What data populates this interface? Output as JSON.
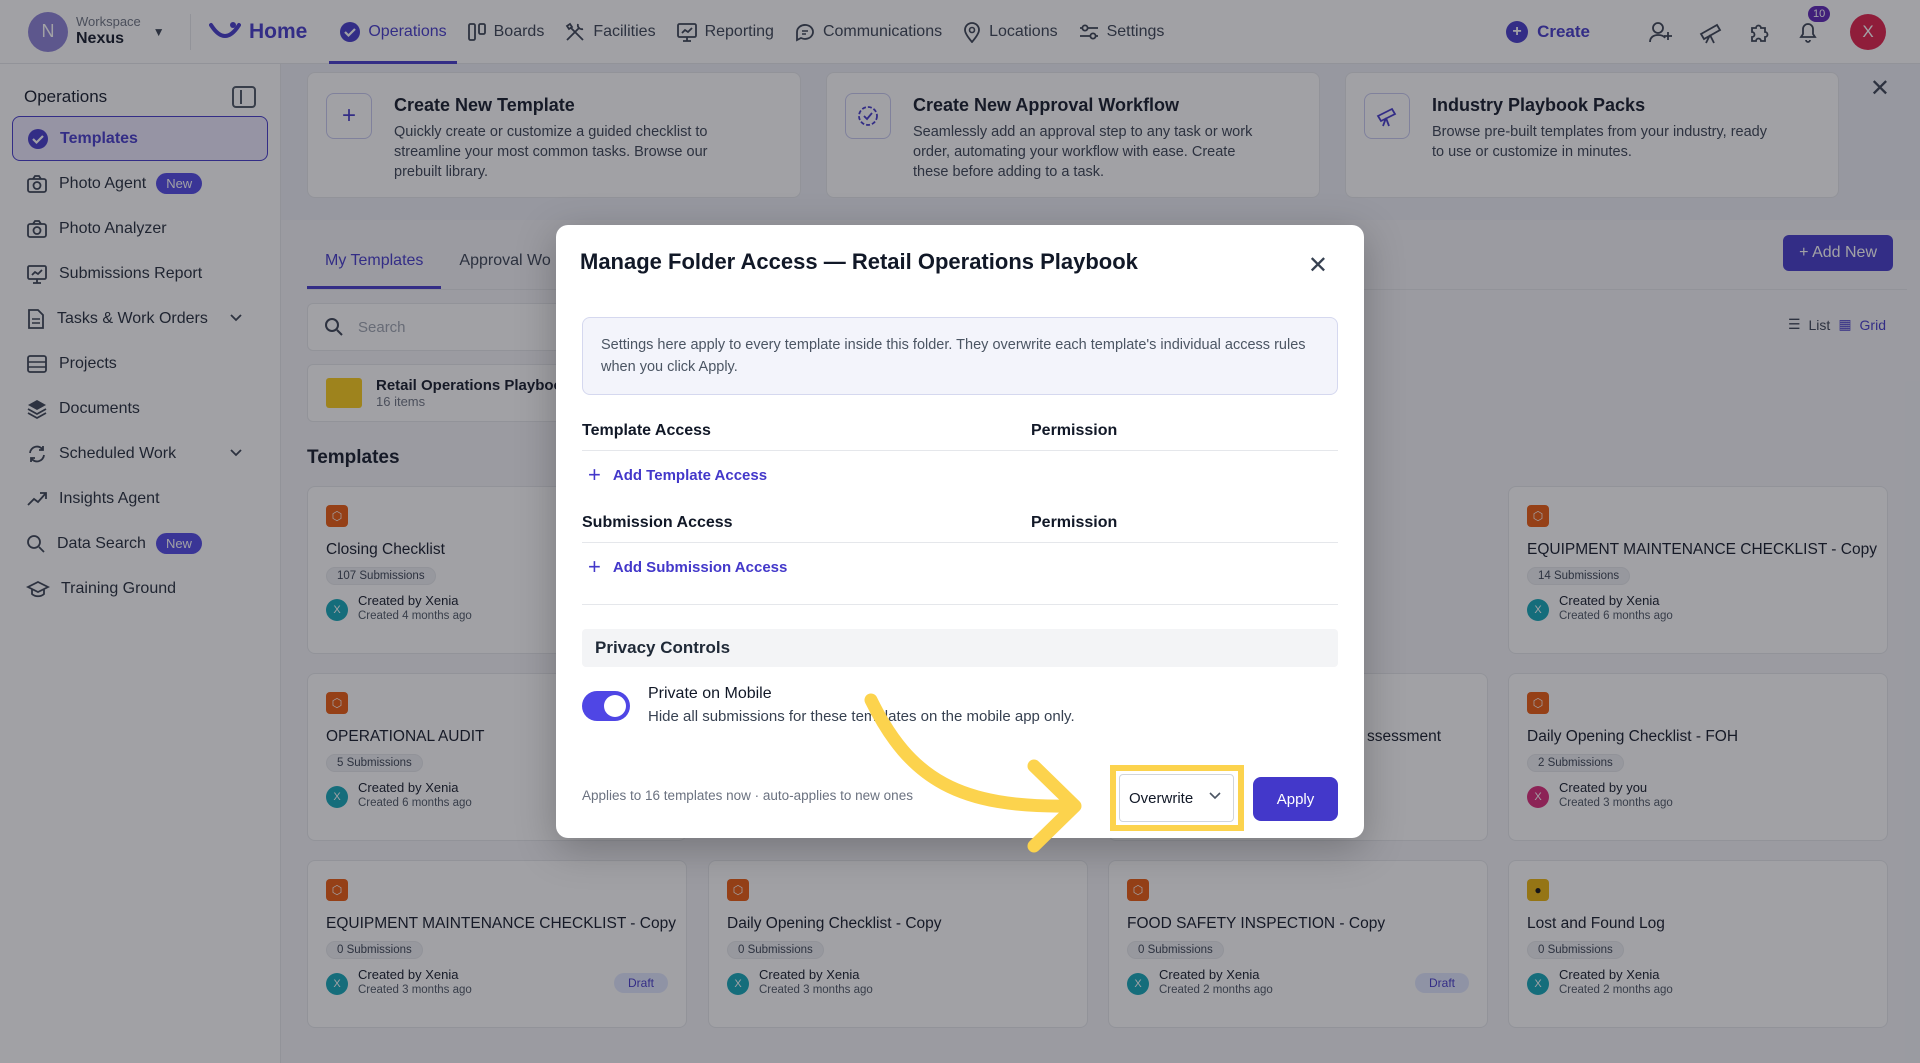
{
  "topnav": {
    "workspace_label": "Workspace",
    "workspace_name": "Nexus",
    "workspace_initial": "N",
    "home": "Home",
    "items": [
      "Operations",
      "Boards",
      "Facilities",
      "Reporting",
      "Communications",
      "Locations",
      "Settings"
    ],
    "active_item": "Operations",
    "create": "Create",
    "notifications_count": "10",
    "user_initial": "X"
  },
  "sidebar": {
    "title": "Operations",
    "items": [
      {
        "label": "Templates",
        "icon": "check-circle-icon",
        "active": true
      },
      {
        "label": "Photo Agent",
        "icon": "camera-icon",
        "badge": "New"
      },
      {
        "label": "Photo Analyzer",
        "icon": "camera-icon"
      },
      {
        "label": "Submissions Report",
        "icon": "report-icon"
      },
      {
        "label": "Tasks & Work Orders",
        "icon": "document-icon",
        "expandable": true
      },
      {
        "label": "Projects",
        "icon": "projects-icon"
      },
      {
        "label": "Documents",
        "icon": "layers-icon"
      },
      {
        "label": "Scheduled Work",
        "icon": "refresh-icon",
        "expandable": true
      },
      {
        "label": "Insights Agent",
        "icon": "trend-icon"
      },
      {
        "label": "Data Search",
        "icon": "search-icon",
        "badge": "New"
      },
      {
        "label": "Training Ground",
        "icon": "graduation-icon"
      }
    ]
  },
  "promo": [
    {
      "title": "Create New Template",
      "desc": "Quickly create or customize a guided checklist to streamline your most common tasks. Browse our prebuilt library.",
      "icon": "plus-icon"
    },
    {
      "title": "Create New Approval Workflow",
      "desc": "Seamlessly add an approval step to any task or work order, automating your workflow with ease. Create these before adding to a task.",
      "icon": "approval-icon"
    },
    {
      "title": "Industry Playbook Packs",
      "desc": "Browse pre-built templates from your industry, ready to use or customize in minutes.",
      "icon": "telescope-icon"
    }
  ],
  "tabs": [
    "My Templates",
    "Approval Wo"
  ],
  "add_new": "Add New",
  "view_toggle": {
    "list": "List",
    "grid": "Grid"
  },
  "search_placeholder": "Search",
  "folder": {
    "name": "Retail Operations Playboo",
    "count": "16 items"
  },
  "templates_title": "Templates",
  "cards": [
    {
      "title": "Closing Checklist",
      "subs": "107 Submissions",
      "by": "Created by Xenia",
      "ago": "Created 4 months ago",
      "av": "X"
    },
    {
      "title": "EQUIPMENT MAINTENANCE CHECKLIST - Copy",
      "subs": "14 Submissions",
      "by": "Created by Xenia",
      "ago": "Created 6 months ago",
      "av": "X"
    },
    {
      "title": "OPERATIONAL AUDIT",
      "subs": "5 Submissions",
      "by": "Created by Xenia",
      "ago": "Created 6 months ago",
      "av": "X"
    },
    {
      "title": "ssessment",
      "subs": "",
      "by": "",
      "ago": "",
      "av": ""
    },
    {
      "title": "Daily Opening Checklist - FOH",
      "subs": "2 Submissions",
      "by": "Created by you",
      "ago": "Created 3 months ago",
      "av": "X"
    },
    {
      "title": "EQUIPMENT MAINTENANCE CHECKLIST - Copy",
      "subs": "0 Submissions",
      "by": "Created by Xenia",
      "ago": "Created 3 months ago",
      "av": "X",
      "draft": "Draft"
    },
    {
      "title": "Daily Opening Checklist - Copy",
      "subs": "0 Submissions",
      "by": "Created by Xenia",
      "ago": "Created 3 months ago",
      "av": "X"
    },
    {
      "title": "FOOD SAFETY INSPECTION - Copy",
      "subs": "0 Submissions",
      "by": "Created by Xenia",
      "ago": "Created 2 months ago",
      "av": "X",
      "draft": "Draft"
    },
    {
      "title": "Lost and Found Log",
      "subs": "0 Submissions",
      "by": "Created by Xenia",
      "ago": "Created 2 months ago",
      "av": "X"
    }
  ],
  "modal": {
    "title": "Manage Folder Access — Retail Operations Playbook",
    "info": "Settings here apply to every template inside this folder. They overwrite each template's individual access rules when you click Apply.",
    "template_access": "Template Access",
    "permission": "Permission",
    "add_template_access": "Add Template Access",
    "submission_access": "Submission Access",
    "add_submission_access": "Add Submission Access",
    "privacy_controls": "Privacy Controls",
    "private_on_mobile": "Private on Mobile",
    "private_desc": "Hide all submissions for these templates on the mobile app only.",
    "private_on": true,
    "footer_note": "Applies to 16 templates now · auto-applies to new ones",
    "mode_value": "Overwrite",
    "apply": "Apply"
  },
  "colors": {
    "accent": "#4338ca",
    "highlight": "#fcd34d"
  }
}
